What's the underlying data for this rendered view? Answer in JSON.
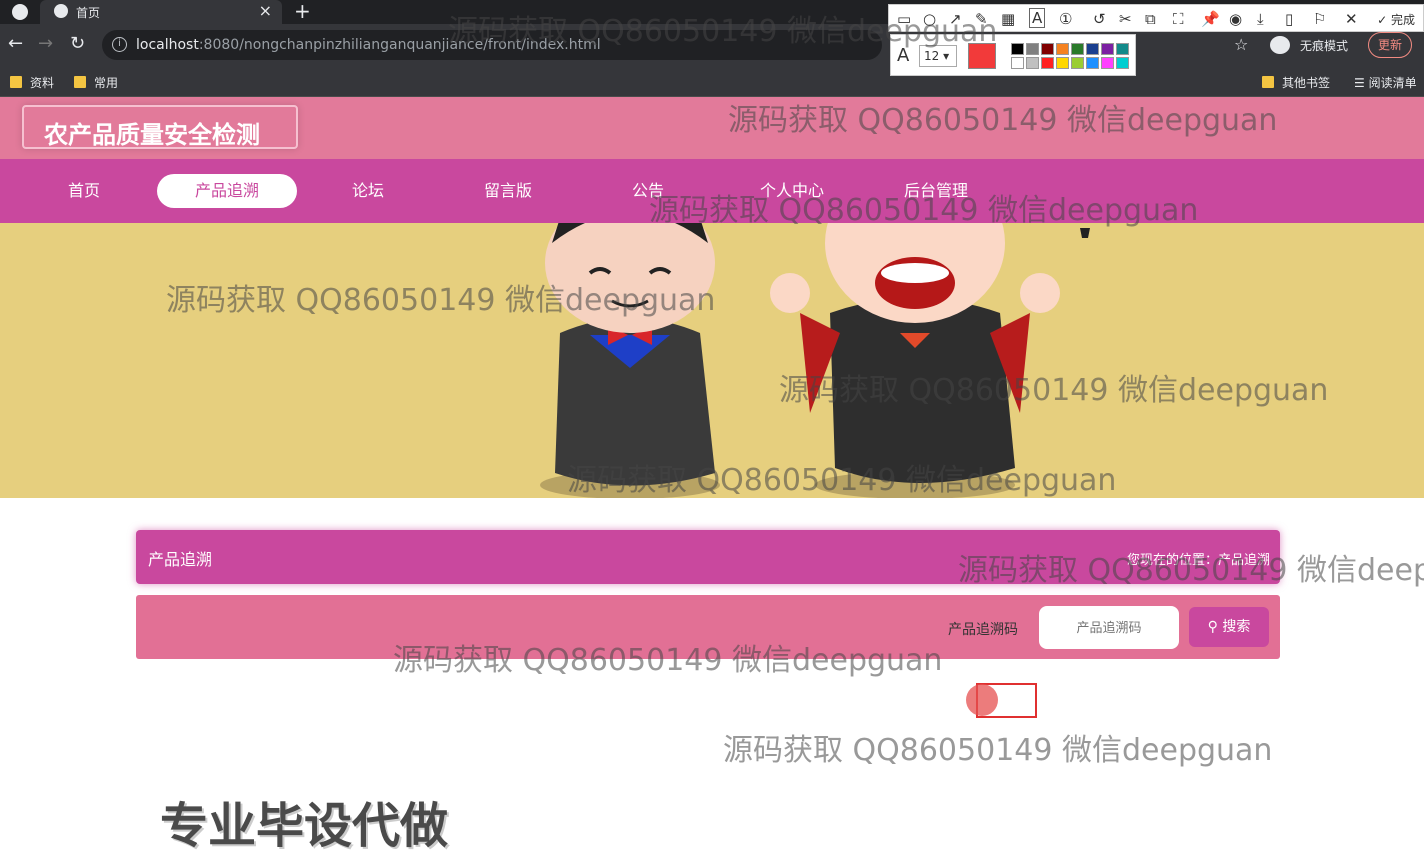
{
  "browser": {
    "tab_title": "首页",
    "tab_close": "×",
    "new_tab": "+",
    "url_host": "localhost",
    "url_rest": ":8080/nongchanpinzhilianganquanjiance/front/index.html",
    "incognito": "无痕模式",
    "update": "更新",
    "bookmarks": [
      "资料",
      "常用"
    ],
    "bookmarks_right": [
      "其他书签",
      "阅读清单"
    ]
  },
  "snip_tool": {
    "font_size": "12",
    "done": "完成",
    "current_color": "#f23a3a",
    "swatches": [
      "#000000",
      "#808080",
      "#800000",
      "#f58220",
      "#2a7a2a",
      "#1a3f8f",
      "#7b1fa2",
      "#138a8a",
      "#ffffff",
      "#c0c0c0",
      "#ff2020",
      "#ffd700",
      "#9acd32",
      "#1e90ff",
      "#ff40ff",
      "#00ced1"
    ]
  },
  "site": {
    "logo_text": "农产品质量安全检测",
    "nav": [
      "首页",
      "产品追溯",
      "论坛",
      "留言版",
      "公告",
      "个人中心",
      "后台管理"
    ],
    "active_nav": "产品追溯"
  },
  "section": {
    "title": "产品追溯",
    "breadcrumb": "您现在的位置：产品追溯"
  },
  "search": {
    "label": "产品追溯码",
    "placeholder": "产品追溯码",
    "button": "搜索"
  },
  "promo": "专业毕设代做",
  "watermark": "源码获取 QQ86050149 微信deepguan"
}
